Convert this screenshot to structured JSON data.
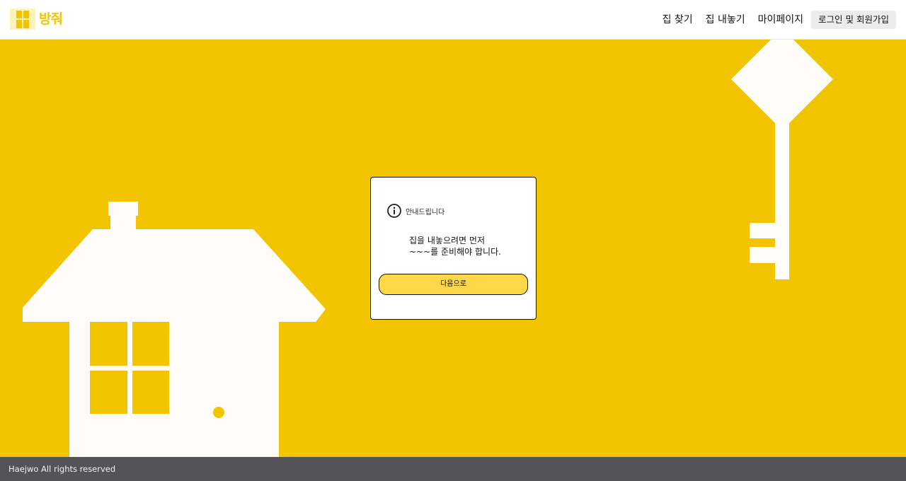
{
  "header": {
    "logo_text": "방줘",
    "nav": [
      {
        "label": "집 찾기"
      },
      {
        "label": "집 내놓기"
      },
      {
        "label": "마이페이지"
      }
    ],
    "login_label": "로그인 및 회원가입"
  },
  "dialog": {
    "title": "안내드립니다",
    "message_lines": [
      "집을 내놓으려면 먼저",
      "~~~를 준비해야 합니다."
    ],
    "next_label": "다음으로"
  },
  "footer": {
    "text": "Haejwo All rights reserved"
  },
  "colors": {
    "background": "#f3c400",
    "accent": "#ffd84a",
    "illustration": "#fdfcf8",
    "footer": "#545358"
  },
  "icons": {
    "logo": "window-logo-icon",
    "dialog": "info-icon"
  }
}
